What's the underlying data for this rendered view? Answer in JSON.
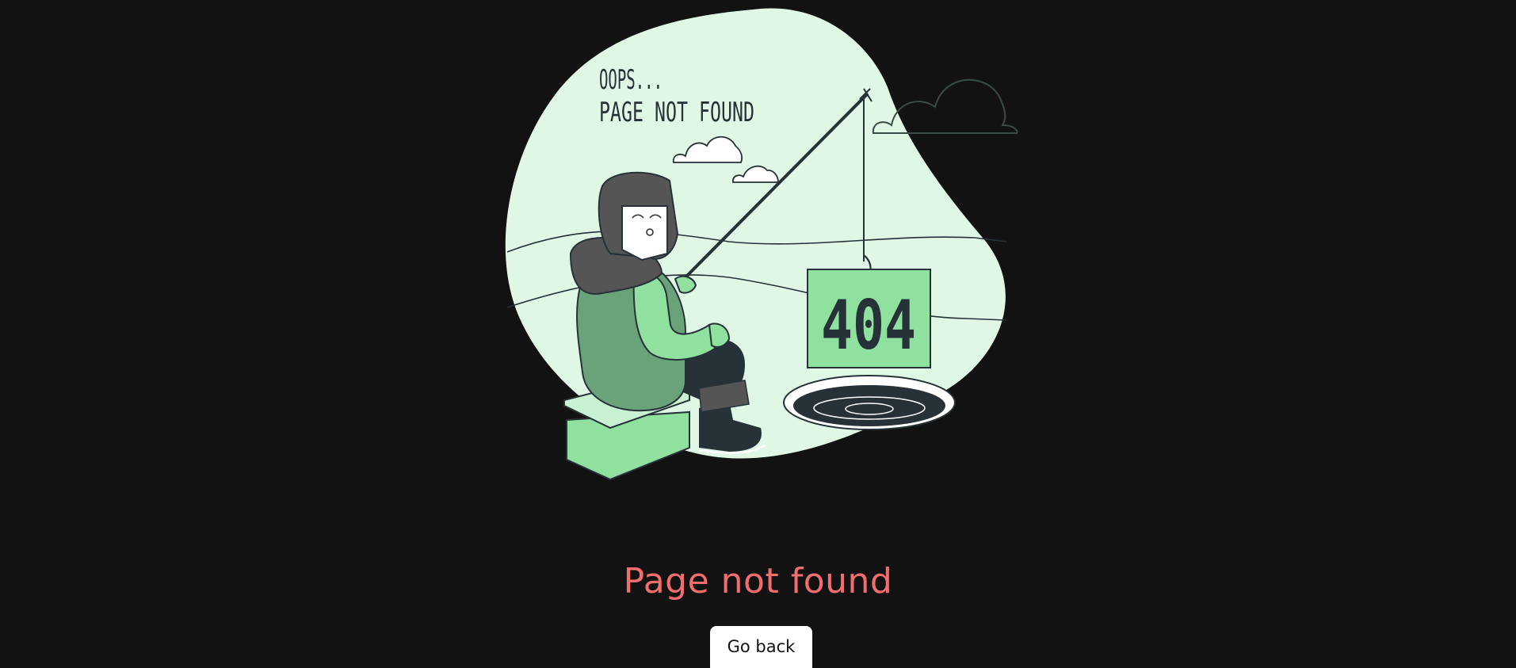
{
  "illustration": {
    "heading_line1": "OOPS...",
    "heading_line2": "PAGE NOT FOUND",
    "sign_text": "404",
    "colors": {
      "blob": "#e0f7e6",
      "accent_green": "#90e0a0",
      "dark_green": "#6aa37a",
      "ink": "#263238",
      "coat_dark": "#555555"
    }
  },
  "error": {
    "title": "Page not found",
    "title_color": "#f26d6d"
  },
  "actions": {
    "back_label": "Go back"
  }
}
